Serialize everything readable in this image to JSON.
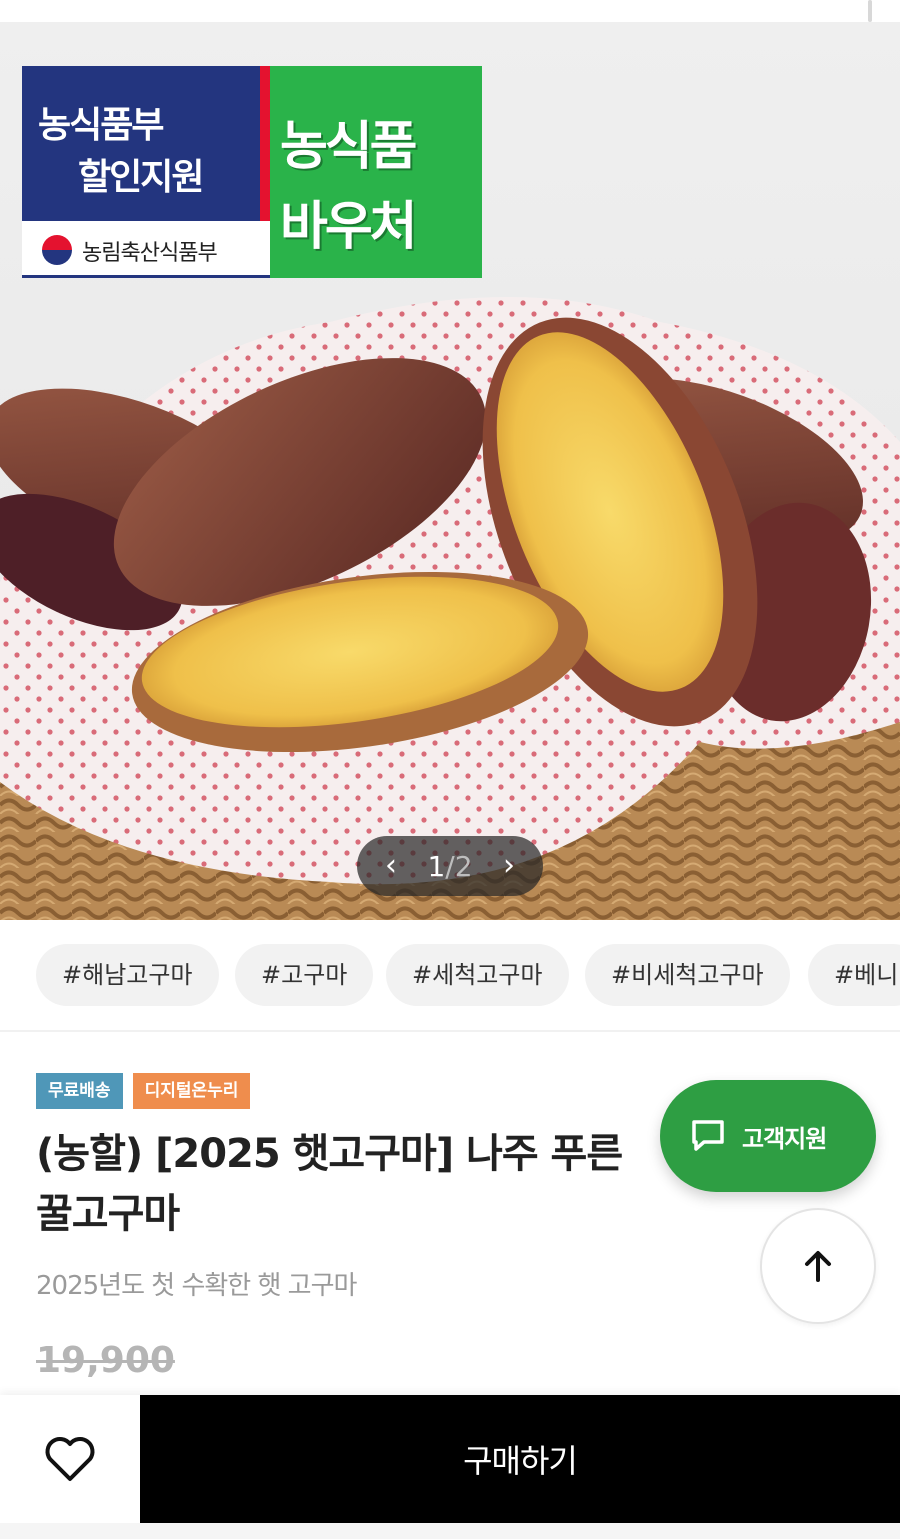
{
  "badge": {
    "left_line1": "농식품부",
    "left_line2": "할인지원",
    "ministry": "농림축산식품부",
    "voucher_line1": "농식품",
    "voucher_line2": "바우처"
  },
  "pager": {
    "prev_icon": "chevron-left-icon",
    "current": "1",
    "separator": "/",
    "total": "2",
    "next_icon": "chevron-right-icon"
  },
  "tags": [
    "#해남고구마",
    "#고구마",
    "#세척고구마",
    "#비세척고구마",
    "#베니"
  ],
  "chips": {
    "free_shipping": "무료배송",
    "onnuri": "디지털온누리"
  },
  "product": {
    "title_line1": "(농할) [2025 햇고구마] 나주 푸른",
    "title_line2": "꿀고구마",
    "subtitle": "2025년도 첫 수확한 햇 고구마",
    "original_price": "19,900"
  },
  "floating": {
    "support_label": "고객지원",
    "support_icon": "chat-bubble-icon",
    "top_icon": "arrow-up-icon"
  },
  "bottom_bar": {
    "wish_icon": "heart-icon",
    "buy_label": "구매하기"
  },
  "colors": {
    "support_green": "#2e9e43",
    "badge_navy": "#23357f",
    "voucher_green": "#2ab34a",
    "chip_blue": "#4f97b8",
    "chip_orange": "#ef8d4d"
  }
}
